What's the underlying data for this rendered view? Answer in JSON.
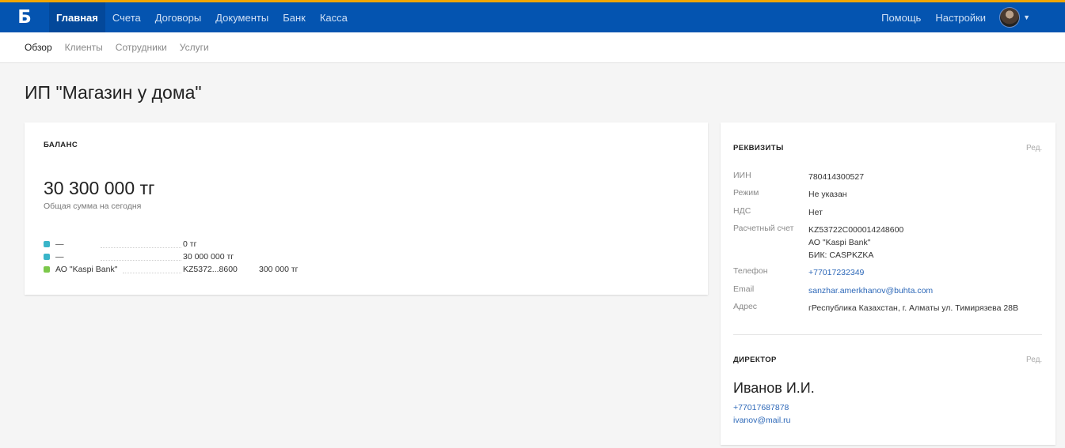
{
  "logo": "Б",
  "nav": {
    "items": [
      "Главная",
      "Счета",
      "Договоры",
      "Документы",
      "Банк",
      "Касса"
    ],
    "right": [
      "Помощь",
      "Настройки"
    ]
  },
  "subnav": [
    "Обзор",
    "Клиенты",
    "Сотрудники",
    "Услуги"
  ],
  "page_title": "ИП \"Магазин у дома\"",
  "balance": {
    "title": "БАЛАНС",
    "amount": "30 300 000 тг",
    "subtitle": "Общая сумма на сегодня",
    "accounts": [
      {
        "name": "—",
        "col1": "0 тг",
        "col2": "",
        "color": "#3ab5c9"
      },
      {
        "name": "—",
        "col1": "30 000 000 тг",
        "col2": "",
        "color": "#3ab5c9"
      },
      {
        "name": "АО \"Kaspi Bank\"",
        "col1": "KZ5372...8600",
        "col2": "300 000 тг",
        "color": "#7cc84b"
      }
    ]
  },
  "requisites": {
    "title": "РЕКВИЗИТЫ",
    "edit": "Ред.",
    "rows": {
      "iin": {
        "label": "ИИН",
        "value": "780414300527"
      },
      "regime": {
        "label": "Режим",
        "value": "Не указан"
      },
      "nds": {
        "label": "НДС",
        "value": "Нет"
      },
      "account": {
        "label": "Расчетный счет",
        "line1": "KZ53722C000014248600",
        "line2": "АО \"Kaspi Bank\"",
        "line3": "БИК: CASPKZKA"
      },
      "phone": {
        "label": "Телефон",
        "value": "+77017232349"
      },
      "email": {
        "label": "Email",
        "value": "sanzhar.amerkhanov@buhta.com"
      },
      "address": {
        "label": "Адрес",
        "value": "гРеспублика Казахстан, г. Алматы ул. Тимирязева 28В"
      }
    }
  },
  "director": {
    "title": "ДИРЕКТОР",
    "edit": "Ред.",
    "name": "Иванов И.И.",
    "phone": "+77017687878",
    "email": "ivanov@mail.ru"
  }
}
